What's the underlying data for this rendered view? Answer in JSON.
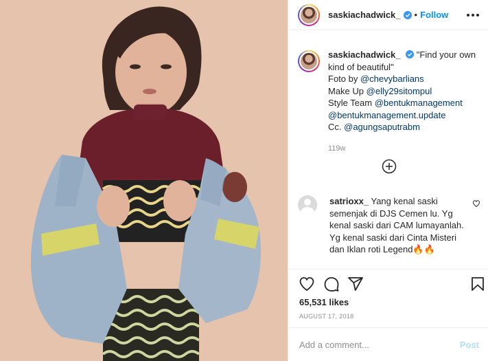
{
  "post": {
    "username": "saskiachadwick_",
    "follow_label": "Follow",
    "separator": "•",
    "caption": {
      "quote": "\"Find your own kind of beautiful\"",
      "photo_by_label": "Foto by",
      "photo_by": "@chevybarlians",
      "makeup_label": "Make Up",
      "makeup": "@elly29sitompul",
      "style_label": "Style Team",
      "style_1": "@bentukmanagement",
      "style_2": "@bentukmanagement.update",
      "cc_label": "Cc.",
      "cc": "@agungsaputrabm",
      "time_ago": "119w"
    },
    "comments": [
      {
        "username": "satrioxx_",
        "text": "Yang kenal saski semenjak di DJS Cemen lu. Yg kenal saski dari CAM lumayanlah. Yg kenal saski dari Cinta Misteri dan Iklan roti Legend🔥🔥"
      }
    ],
    "likes": "65,531 likes",
    "date": "AUGUST 17, 2018",
    "comment_placeholder": "Add a comment...",
    "post_label": "Post"
  },
  "icons": {
    "verified": "verified-badge-icon",
    "more": "more-options-icon",
    "load_more": "load-more-comments-icon",
    "like": "heart-icon",
    "comment": "comment-icon",
    "share": "share-icon",
    "save": "bookmark-icon"
  },
  "colors": {
    "link": "#00376b",
    "follow": "#0095f6",
    "muted": "#8e8e8e",
    "post_disabled": "#b2dffc"
  }
}
